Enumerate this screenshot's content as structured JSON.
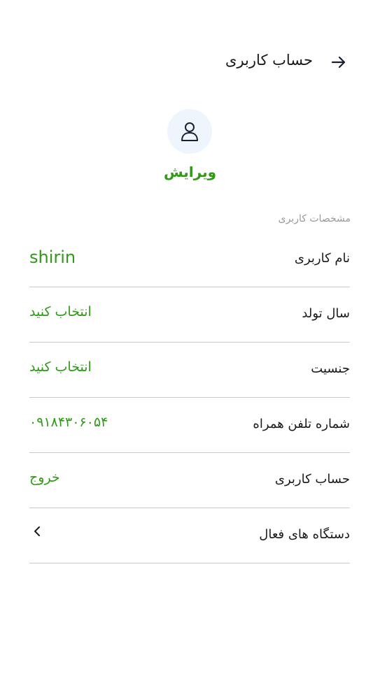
{
  "header": {
    "title": "حساب کاربری"
  },
  "profile": {
    "edit_label": "ویرایش"
  },
  "section": {
    "title": "مشخصات کاربری"
  },
  "rows": [
    {
      "label": "نام کاربری",
      "value": "shirin"
    },
    {
      "label": "سال تولد",
      "value": "انتخاب کنید"
    },
    {
      "label": "جنسیت",
      "value": "انتخاب کنید"
    },
    {
      "label": "شماره تلفن همراه",
      "value": "۰۹۱۸۴۳۰۶۰۵۴"
    },
    {
      "label": "حساب کاربری",
      "value": "خروج"
    },
    {
      "label": "دستگاه های فعال"
    }
  ],
  "colors": {
    "accent": "#2f9a16",
    "avatar_bg": "#eef5fd",
    "divider": "#c8c8c8"
  },
  "icons": {
    "back": "arrow-right-icon",
    "avatar": "user-icon",
    "chevron": "chevron-left-icon"
  }
}
